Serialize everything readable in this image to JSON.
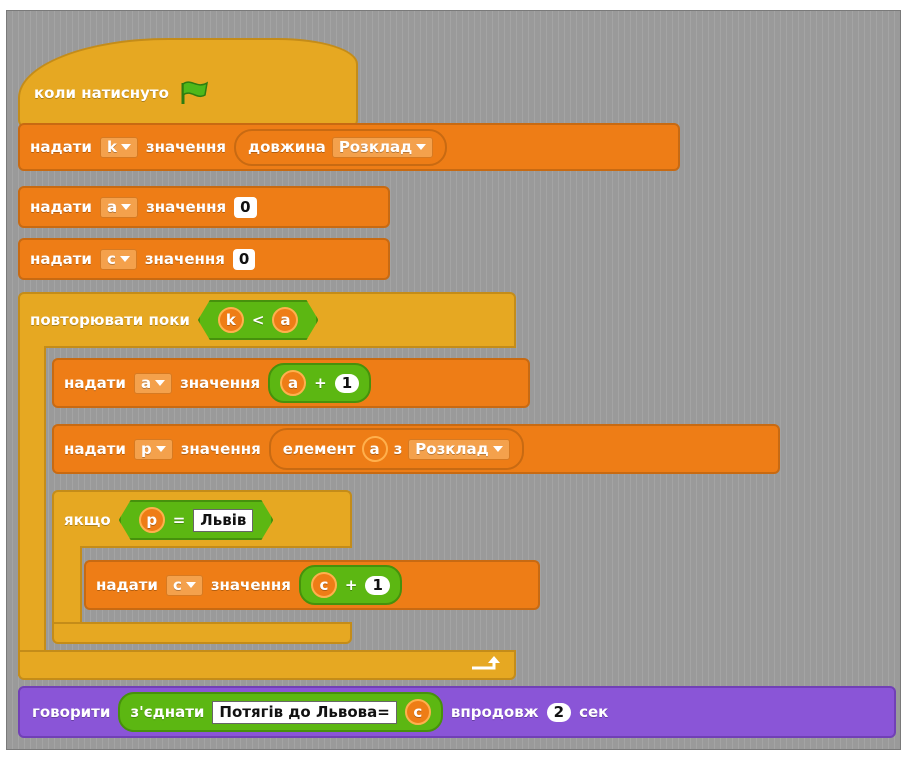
{
  "hat": {
    "label": "коли натиснуто"
  },
  "blocks": {
    "set_k": {
      "label": "надати",
      "var": "k",
      "value_label": "значення",
      "reporter": "довжина",
      "list": "Розклад"
    },
    "set_a0": {
      "label": "надати",
      "var": "a",
      "value_label": "значення",
      "value": "0"
    },
    "set_c0": {
      "label": "надати",
      "var": "c",
      "value_label": "значення",
      "value": "0"
    },
    "repeat": {
      "label": "повторювати поки",
      "left": "k",
      "op": "<",
      "right": "a"
    },
    "set_a_inc": {
      "label": "надати",
      "var": "a",
      "value_label": "значення",
      "lhs": "a",
      "op": "+",
      "rhs": "1"
    },
    "set_p": {
      "label": "надати",
      "var": "p",
      "value_label": "значення",
      "reporter": "елемент",
      "index": "a",
      "of": "з",
      "list": "Розклад"
    },
    "if": {
      "label": "якщо",
      "left": "p",
      "op": "=",
      "right": "Львів"
    },
    "set_c_inc": {
      "label": "надати",
      "var": "c",
      "value_label": "значення",
      "lhs": "c",
      "op": "+",
      "rhs": "1"
    },
    "say": {
      "label": "говорити",
      "join": "з'єднати",
      "text": "Потягів до Львова=",
      "var": "c",
      "for_label": "впродовж",
      "secs": "2",
      "unit": "сек"
    }
  },
  "colors": {
    "events": "#e6a822",
    "data": "#ee7d16",
    "control": "#e6a822",
    "operators": "#5cb712",
    "looks": "#8a55d7"
  }
}
